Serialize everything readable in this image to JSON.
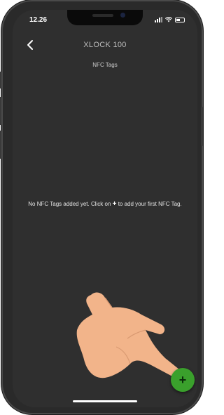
{
  "status_bar": {
    "time": "12.26"
  },
  "header": {
    "title": "XLOCK 100",
    "back_icon": "chevron-left-icon"
  },
  "section": {
    "title": "NFC Tags"
  },
  "empty_state": {
    "text_before": "No NFC Tags added yet. Click on ",
    "plus_symbol": "+",
    "text_after": " to add your first NFC Tag."
  },
  "fab": {
    "label": "+",
    "color": "#3aa02c"
  },
  "colors": {
    "background": "#2f2f2f",
    "hand": "#f2b48a"
  }
}
